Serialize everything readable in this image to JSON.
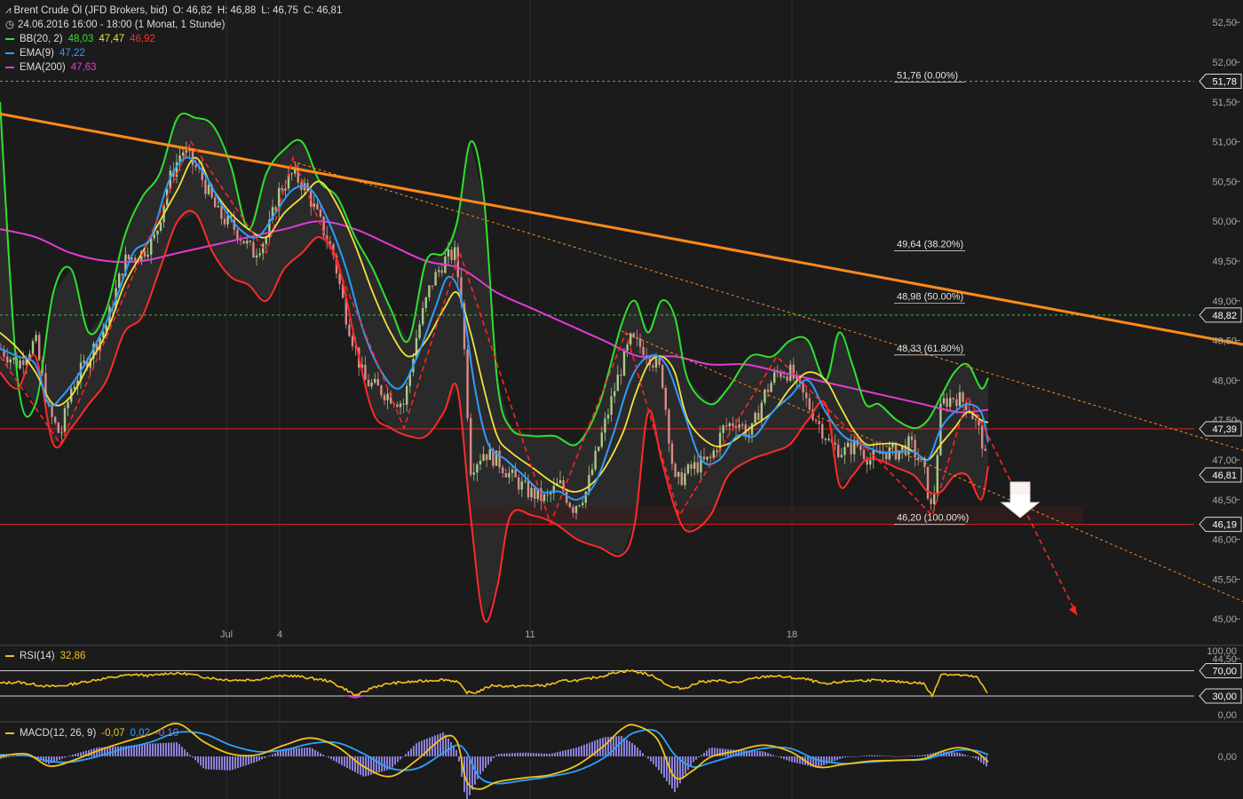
{
  "header": {
    "title": "Brent Crude Öl (JFD Brokers, bid)",
    "ohlc": {
      "o": "O: 46,82",
      "h": "H: 46,88",
      "l": "L: 46,75",
      "c": "C: 46,81"
    },
    "period": "24.06.2016 16:00 - 18:00 (1 Monat, 1 Stunde)",
    "indicators": [
      {
        "label": "BB(20, 2)",
        "values": [
          "48,03",
          "47,47",
          "46,92"
        ],
        "value_colors": [
          "#2fe02f",
          "#f2e23c",
          "#ff2b2b"
        ],
        "color": "#2fe02f"
      },
      {
        "label": "EMA(9)",
        "values": [
          "47,22"
        ],
        "value_colors": [
          "#2e9bff"
        ],
        "color": "#2e9bff"
      },
      {
        "label": "EMA(200)",
        "values": [
          "47,63"
        ],
        "value_colors": [
          "#e23bd6"
        ],
        "color": "#e23bd6"
      }
    ]
  },
  "colors": {
    "background": "#1b1b1b",
    "bb_upper": "#2fe02f",
    "bb_middle": "#f2e23c",
    "bb_lower": "#ff2b2b",
    "ema9": "#2e9bff",
    "ema200": "#e23bd6",
    "trendline": "#ff8a1a",
    "support": "#e81e1e",
    "fib_line": "#39c439",
    "rsi": "#f2c21c",
    "macd_line": "#f2c21c",
    "macd_signal": "#2aa4ff",
    "macd_hist": "#8a7fd8",
    "candle_up": "#a9c98a",
    "candle_down": "#d98a8a",
    "axis_text": "#a8a8a8"
  },
  "price_axis": {
    "ticks": [
      "52,50",
      "52,00",
      "51,50",
      "51,00",
      "50,50",
      "50,00",
      "49,50",
      "49,00",
      "48,50",
      "48,00",
      "47,50",
      "47,00",
      "46,50",
      "46,00",
      "45,50",
      "45,00",
      "44,50"
    ],
    "tags": [
      {
        "label": "51,78",
        "value": 51.76,
        "style": "dark"
      },
      {
        "label": "48,82",
        "value": 48.82,
        "style": "dark"
      },
      {
        "label": "47,39",
        "value": 47.39,
        "style": "dark"
      },
      {
        "label": "46,81",
        "value": 46.81,
        "style": "dark"
      },
      {
        "label": "46,19",
        "value": 46.19,
        "style": "dark"
      }
    ]
  },
  "time_axis": {
    "labels": [
      {
        "label": "Jul",
        "t": 255
      },
      {
        "label": "4",
        "t": 315
      },
      {
        "label": "11",
        "t": 597
      },
      {
        "label": "18",
        "t": 892
      }
    ]
  },
  "fibonacci": [
    {
      "label": "51,76 (0.00%)",
      "value": 51.76
    },
    {
      "label": "49,64 (38.20%)",
      "value": 49.64
    },
    {
      "label": "48,98 (50.00%)",
      "value": 48.98
    },
    {
      "label": "48,33 (61.80%)",
      "value": 48.33
    },
    {
      "label": "46,20 (100.00%)",
      "value": 46.2
    }
  ],
  "rsi": {
    "label": "RSI(14)",
    "value": "32,86",
    "ticks": [
      "100,00",
      "0,00"
    ],
    "levels": [
      {
        "label": "70,00",
        "value": 70
      },
      {
        "label": "30,00",
        "value": 30
      }
    ]
  },
  "macd": {
    "label": "MACD(12, 26, 9)",
    "values": [
      "-0,07",
      "0,02",
      "-0,10"
    ],
    "value_colors": [
      "#f2c21c",
      "#2aa4ff",
      "#8a7fd8"
    ],
    "ticks": [
      "0,00"
    ]
  },
  "chart_data": {
    "type": "candlestick",
    "instrument": "Brent Crude Öl (JFD Brokers, bid)",
    "timeframe": "1 Stunde",
    "price_range": [
      44.45,
      52.6
    ],
    "key_levels": {
      "fib_0": 51.76,
      "fib_382": 49.64,
      "fib_50": 48.98,
      "fib_618": 48.33,
      "fib_100": 46.2,
      "support": 46.19,
      "resistance": 47.39,
      "green_dashed": 48.82
    },
    "close_path": {
      "t": [
        0,
        20,
        40,
        55,
        68,
        80,
        100,
        120,
        140,
        160,
        175,
        190,
        205,
        225,
        245,
        265,
        285,
        300,
        315,
        330,
        345,
        360,
        375,
        390,
        410,
        425,
        440,
        455,
        470,
        485,
        500,
        512,
        520,
        530,
        545,
        560,
        575,
        595,
        615,
        630,
        645,
        660,
        680,
        695,
        710,
        725,
        745,
        760,
        780,
        800,
        815,
        830,
        845,
        860,
        875,
        890,
        905,
        920,
        935,
        950,
        965,
        980,
        995,
        1010,
        1025,
        1040,
        1050,
        1060,
        1075,
        1090,
        1105,
        1113
      ],
      "price": [
        48.4,
        48.2,
        48.5,
        47.6,
        47.3,
        47.9,
        48.3,
        48.7,
        49.5,
        49.6,
        49.8,
        50.5,
        50.9,
        50.6,
        50.1,
        49.9,
        49.6,
        49.8,
        50.4,
        50.6,
        50.4,
        50.0,
        49.6,
        48.8,
        48.0,
        47.9,
        47.8,
        47.7,
        48.6,
        49.2,
        49.5,
        49.6,
        49.0,
        46.9,
        47.1,
        47.0,
        46.8,
        46.6,
        46.5,
        46.7,
        46.4,
        46.6,
        47.4,
        48.0,
        48.5,
        48.4,
        48.1,
        46.7,
        46.9,
        47.0,
        47.4,
        47.5,
        47.3,
        47.8,
        48.1,
        48.1,
        47.8,
        47.5,
        47.2,
        47.1,
        47.2,
        47.0,
        47.1,
        47.1,
        47.2,
        46.9,
        46.3,
        47.7,
        47.8,
        47.7,
        47.3,
        46.81
      ]
    },
    "bb_upper": {
      "t": [
        0,
        20,
        40,
        60,
        80,
        100,
        120,
        140,
        160,
        180,
        200,
        220,
        240,
        260,
        280,
        300,
        320,
        340,
        360,
        380,
        400,
        420,
        440,
        460,
        480,
        500,
        515,
        530,
        545,
        560,
        575,
        600,
        625,
        650,
        675,
        700,
        715,
        730,
        745,
        760,
        775,
        800,
        820,
        845,
        870,
        890,
        910,
        930,
        945,
        960,
        975,
        990,
        1010,
        1030,
        1045,
        1060,
        1075,
        1090,
        1105,
        1113
      ],
      "price": [
        51.5,
        48.0,
        47.7,
        49.1,
        49.4,
        48.6,
        48.9,
        49.8,
        50.3,
        50.6,
        51.3,
        51.3,
        51.2,
        50.7,
        49.9,
        50.6,
        50.9,
        51.0,
        50.5,
        50.3,
        49.8,
        49.4,
        48.9,
        48.5,
        49.5,
        49.6,
        50.0,
        51.0,
        50.3,
        48.0,
        47.4,
        47.3,
        47.3,
        47.2,
        47.7,
        48.7,
        49.0,
        48.6,
        49.0,
        48.8,
        48.0,
        47.7,
        47.9,
        48.3,
        48.3,
        48.5,
        48.5,
        48.0,
        48.6,
        48.2,
        47.7,
        47.7,
        47.5,
        47.4,
        47.5,
        47.8,
        48.1,
        48.2,
        47.9,
        48.03
      ]
    },
    "bb_middle": {
      "t": [
        0,
        20,
        40,
        60,
        80,
        100,
        120,
        140,
        160,
        180,
        200,
        220,
        240,
        260,
        280,
        300,
        320,
        340,
        360,
        380,
        400,
        420,
        440,
        460,
        480,
        500,
        515,
        530,
        545,
        560,
        575,
        600,
        625,
        650,
        675,
        700,
        715,
        730,
        745,
        760,
        775,
        800,
        820,
        845,
        870,
        890,
        910,
        930,
        945,
        960,
        975,
        990,
        1010,
        1030,
        1045,
        1060,
        1075,
        1090,
        1105,
        1113
      ],
      "price": [
        48.6,
        48.4,
        48.1,
        47.7,
        47.8,
        48.2,
        48.6,
        49.2,
        49.6,
        50.0,
        50.4,
        50.8,
        50.4,
        50.1,
        49.9,
        49.8,
        50.1,
        50.3,
        50.5,
        50.2,
        49.7,
        49.1,
        48.6,
        48.3,
        48.5,
        48.9,
        49.1,
        48.6,
        47.9,
        47.3,
        47.1,
        46.9,
        46.7,
        46.6,
        46.8,
        47.3,
        47.8,
        48.2,
        48.3,
        48.1,
        47.5,
        47.2,
        47.2,
        47.4,
        47.6,
        47.9,
        48.1,
        48.0,
        47.7,
        47.4,
        47.2,
        47.2,
        47.2,
        47.1,
        47.0,
        47.2,
        47.4,
        47.6,
        47.5,
        47.47
      ]
    },
    "bb_lower": {
      "t": [
        0,
        20,
        40,
        60,
        80,
        100,
        120,
        140,
        160,
        180,
        200,
        220,
        240,
        260,
        280,
        300,
        320,
        340,
        360,
        380,
        400,
        420,
        440,
        460,
        480,
        500,
        515,
        530,
        545,
        560,
        575,
        600,
        625,
        650,
        675,
        700,
        715,
        730,
        745,
        760,
        775,
        800,
        820,
        845,
        870,
        890,
        910,
        930,
        945,
        960,
        975,
        990,
        1010,
        1030,
        1045,
        1060,
        1075,
        1090,
        1105,
        1113
      ],
      "price": [
        48.1,
        47.9,
        48.3,
        47.2,
        47.4,
        47.7,
        48.0,
        48.6,
        48.8,
        49.4,
        50.0,
        50.1,
        49.6,
        49.3,
        49.2,
        49.0,
        49.4,
        49.6,
        49.8,
        49.5,
        48.5,
        47.6,
        47.4,
        47.3,
        47.3,
        47.6,
        47.9,
        46.3,
        45.0,
        45.4,
        46.3,
        46.3,
        46.2,
        46.0,
        45.9,
        45.8,
        46.2,
        47.6,
        47.0,
        46.4,
        46.1,
        46.3,
        46.8,
        47.0,
        47.1,
        47.2,
        47.5,
        47.7,
        46.7,
        46.8,
        47.0,
        47.0,
        46.9,
        46.8,
        46.6,
        46.6,
        46.8,
        46.8,
        46.5,
        46.92
      ]
    },
    "ema9": {
      "t": [
        0,
        20,
        40,
        55,
        70,
        90,
        110,
        130,
        150,
        170,
        190,
        210,
        230,
        250,
        270,
        290,
        310,
        330,
        350,
        370,
        390,
        410,
        430,
        450,
        470,
        490,
        505,
        520,
        535,
        550,
        570,
        590,
        610,
        630,
        650,
        670,
        690,
        710,
        730,
        750,
        770,
        790,
        810,
        830,
        850,
        870,
        890,
        910,
        930,
        950,
        970,
        990,
        1010,
        1030,
        1045,
        1060,
        1075,
        1090,
        1105,
        1113
      ],
      "price": [
        48.4,
        48.3,
        48.2,
        47.7,
        47.8,
        48.1,
        48.5,
        49.0,
        49.6,
        49.8,
        50.5,
        50.8,
        50.6,
        50.2,
        49.9,
        49.8,
        50.1,
        50.4,
        50.4,
        50.0,
        49.4,
        48.6,
        48.1,
        47.9,
        48.3,
        48.9,
        49.3,
        49.0,
        47.9,
        47.2,
        47.0,
        46.8,
        46.6,
        46.6,
        46.5,
        46.7,
        47.3,
        48.0,
        48.3,
        48.2,
        47.6,
        47.0,
        47.0,
        47.3,
        47.3,
        47.6,
        47.8,
        48.0,
        47.6,
        47.3,
        47.2,
        47.1,
        47.1,
        47.1,
        47.0,
        47.4,
        47.6,
        47.7,
        47.6,
        47.22
      ]
    },
    "ema200": {
      "t": [
        0,
        40,
        80,
        120,
        160,
        200,
        240,
        280,
        320,
        360,
        400,
        440,
        480,
        520,
        560,
        600,
        640,
        680,
        720,
        760,
        800,
        840,
        880,
        920,
        960,
        1000,
        1040,
        1080,
        1113
      ],
      "price": [
        49.9,
        49.8,
        49.6,
        49.5,
        49.5,
        49.6,
        49.7,
        49.8,
        49.9,
        50.0,
        49.9,
        49.7,
        49.5,
        49.4,
        49.1,
        48.9,
        48.7,
        48.5,
        48.3,
        48.3,
        48.2,
        48.2,
        48.1,
        48.0,
        47.9,
        47.8,
        47.7,
        47.6,
        47.63
      ]
    },
    "trendline_main": {
      "t": [
        0,
        1400
      ],
      "price": [
        51.35,
        48.45
      ]
    },
    "trendline_dotted_1": {
      "t": [
        330,
        1400
      ],
      "price": [
        50.75,
        47.12
      ]
    },
    "trendline_dotted_2": {
      "t": [
        700,
        1400
      ],
      "price": [
        48.62,
        45.22
      ]
    },
    "projection_arrow": {
      "t": [
        1113,
        1213
      ],
      "price": [
        47.3,
        45.05
      ]
    },
    "rsi_series": {
      "t": [
        0,
        20,
        40,
        55,
        70,
        90,
        110,
        130,
        150,
        170,
        190,
        210,
        230,
        250,
        270,
        290,
        310,
        330,
        350,
        370,
        390,
        400,
        410,
        420,
        440,
        460,
        480,
        500,
        515,
        525,
        535,
        555,
        575,
        595,
        615,
        635,
        655,
        680,
        695,
        710,
        725,
        740,
        755,
        770,
        790,
        810,
        830,
        850,
        870,
        890,
        910,
        930,
        945,
        960,
        980,
        1000,
        1020,
        1040,
        1050,
        1060,
        1080,
        1100,
        1113
      ],
      "value": [
        50,
        52,
        48,
        45,
        46,
        51,
        56,
        60,
        64,
        62,
        66,
        65,
        60,
        56,
        55,
        56,
        61,
        62,
        58,
        54,
        40,
        31,
        36,
        44,
        50,
        52,
        54,
        56,
        53,
        36,
        35,
        47,
        45,
        46,
        47,
        54,
        55,
        62,
        68,
        70,
        66,
        59,
        44,
        42,
        53,
        54,
        51,
        58,
        62,
        59,
        56,
        48,
        52,
        54,
        55,
        53,
        52,
        50,
        30,
        65,
        63,
        60,
        32.86
      ]
    },
    "macd_series": {
      "t": [
        0,
        30,
        55,
        80,
        110,
        140,
        170,
        200,
        230,
        260,
        290,
        320,
        350,
        380,
        410,
        440,
        470,
        500,
        515,
        525,
        540,
        560,
        590,
        620,
        650,
        680,
        700,
        715,
        740,
        760,
        780,
        800,
        830,
        860,
        890,
        920,
        950,
        980,
        1010,
        1040,
        1060,
        1080,
        1100,
        1113
      ],
      "macd": [
        0,
        0.03,
        -0.12,
        -0.06,
        0.07,
        0.18,
        0.28,
        0.41,
        0.18,
        0.03,
        0.02,
        0.14,
        0.23,
        0.12,
        -0.13,
        -0.25,
        -0.04,
        0.24,
        0.18,
        -0.3,
        -0.41,
        -0.32,
        -0.27,
        -0.23,
        -0.11,
        0.13,
        0.34,
        0.39,
        0.22,
        -0.26,
        -0.18,
        -0.01,
        0.07,
        0.14,
        0.06,
        -0.13,
        -0.1,
        -0.06,
        -0.05,
        -0.03,
        0.06,
        0.11,
        0.05,
        -0.07
      ],
      "signal": [
        0.02,
        0.01,
        -0.06,
        -0.07,
        0.0,
        0.1,
        0.18,
        0.3,
        0.28,
        0.14,
        0.06,
        0.08,
        0.16,
        0.17,
        0.03,
        -0.15,
        -0.15,
        0.05,
        0.14,
        0.06,
        -0.26,
        -0.34,
        -0.3,
        -0.25,
        -0.18,
        -0.02,
        0.18,
        0.3,
        0.31,
        0.02,
        -0.13,
        -0.08,
        0.02,
        0.1,
        0.1,
        -0.04,
        -0.09,
        -0.07,
        -0.05,
        -0.04,
        0.02,
        0.08,
        0.07,
        0.02
      ]
    }
  }
}
